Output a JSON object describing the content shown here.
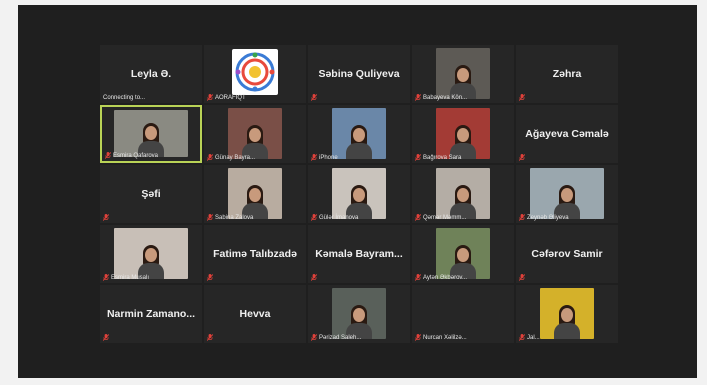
{
  "participants": [
    {
      "name": "Leyla Ə.",
      "status": "Connecting to...",
      "big": true
    },
    {
      "name": "AORAFIQT",
      "logo": true
    },
    {
      "name": "Səbinə Quliyeva",
      "big": true
    },
    {
      "name": "Babayeva Kön...",
      "video": true,
      "bg": "#5d5a55"
    },
    {
      "name": "Zəhra",
      "big": true
    },
    {
      "name": "Esmira Qafarova",
      "video": true,
      "wide": true,
      "active": true,
      "bg": "#8a8a82"
    },
    {
      "name": "Günay Bayra...",
      "video": true,
      "bg": "#7a4f47"
    },
    {
      "name": "iPhone",
      "video": true,
      "bg": "#6a87a8"
    },
    {
      "name": "Bağırova Sara",
      "video": true,
      "bg": "#a33b35"
    },
    {
      "name": "Ağayeva Cəmalə",
      "big": true
    },
    {
      "name": "Şəfi",
      "big": true
    },
    {
      "name": "Sabina Zalova",
      "video": true,
      "bg": "#b8aca0"
    },
    {
      "name": "Gülər İmanova",
      "video": true,
      "bg": "#c9c3bc"
    },
    {
      "name": "Qəmər Məmm...",
      "video": true,
      "bg": "#b4ada5"
    },
    {
      "name": "Zeynəb Əliyeva",
      "video": true,
      "wide": true,
      "bg": "#9aa7ae"
    },
    {
      "name": "Esmira Musalı",
      "video": true,
      "wide": true,
      "bg": "#c8bfb7"
    },
    {
      "name": "Fatimə Talıbzadə",
      "big": true
    },
    {
      "name": "Kəmalə Bayram...",
      "big": true
    },
    {
      "name": "Aytən Əkbərov...",
      "video": true,
      "bg": "#6f8259"
    },
    {
      "name": "Cəfərov Samir",
      "big": true
    },
    {
      "name": "Narmin Zamano...",
      "big": true
    },
    {
      "name": "Hevva",
      "big": true
    },
    {
      "name": "Pərizad Saleh...",
      "video": true,
      "bg": "#59605a"
    },
    {
      "name": "Nurcan Xəlilzə...",
      "video": false
    },
    {
      "name": "Jal...",
      "video": true,
      "bg": "#d4b12a"
    }
  ],
  "colors": {
    "muted_mic": "#e0413a",
    "active_border": "#b9d356",
    "tile_bg": "#262626",
    "screen_bg": "#1f1f1f"
  }
}
